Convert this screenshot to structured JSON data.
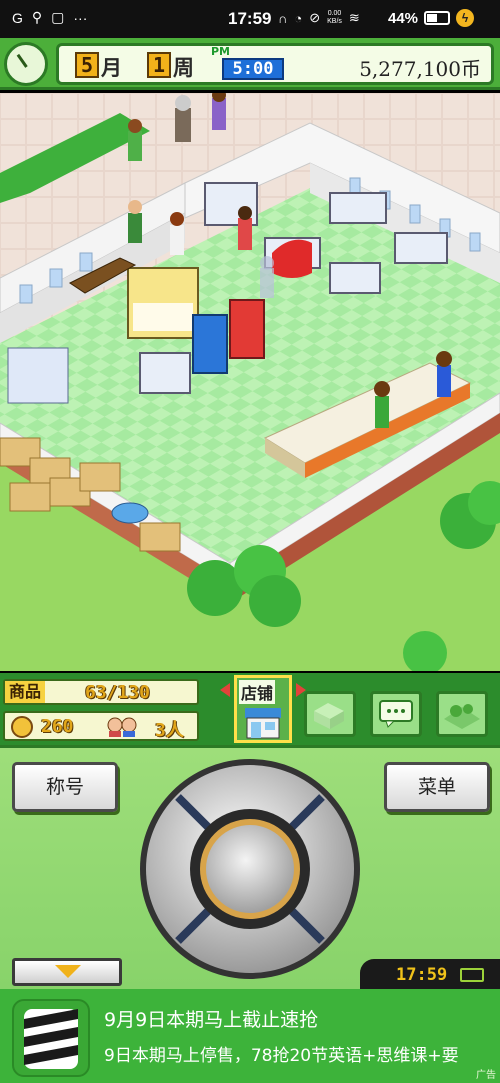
{
  "status_bar": {
    "carrier": "G",
    "time": "17:59",
    "net_speed_value": "0.00",
    "net_speed_unit": "KB/s",
    "battery": "44%"
  },
  "top_bar": {
    "month": "5",
    "month_unit": "月",
    "week": "1",
    "week_unit": "周",
    "ampm": "PM",
    "time": "5:00",
    "money": "5,277,100币"
  },
  "info_panel": {
    "goods_label": "商品",
    "goods_value": "63/130",
    "popularity_value": "260",
    "customers_value": "3人",
    "shop_tab_label": "店铺"
  },
  "controls": {
    "title_button": "称号",
    "menu_button": "菜单",
    "clock_time": "17:59"
  },
  "ad": {
    "title": "9月9日本期马上截止速抢",
    "subtitle": "9日本期马上停售，78抢20节英语+思维课+要",
    "tag": "广告"
  },
  "colors": {
    "ui_green": "#4caf3a",
    "panel_cream": "#f4fce6",
    "accent_orange": "#f2b21a",
    "ad_green": "#3db33a"
  }
}
